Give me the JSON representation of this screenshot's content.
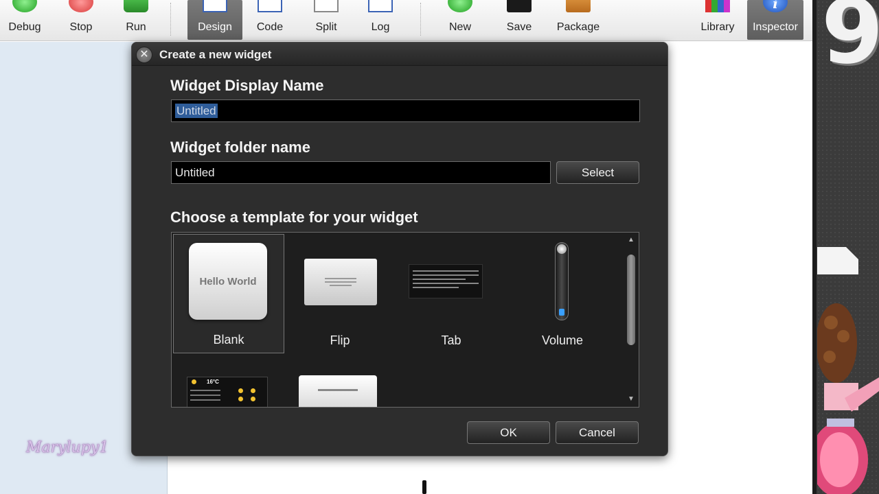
{
  "toolbar": {
    "buttons": [
      {
        "label": "Debug"
      },
      {
        "label": "Stop"
      },
      {
        "label": "Run"
      },
      {
        "label": "Design"
      },
      {
        "label": "Code"
      },
      {
        "label": "Split"
      },
      {
        "label": "Log"
      },
      {
        "label": "New"
      },
      {
        "label": "Save"
      },
      {
        "label": "Package"
      },
      {
        "label": "Library"
      },
      {
        "label": "Inspector"
      }
    ],
    "active": [
      "Design",
      "Inspector"
    ]
  },
  "dialog": {
    "title": "Create a new widget",
    "close_icon": "✕",
    "display_name": {
      "label": "Widget Display Name",
      "value": "Untitled"
    },
    "folder_name": {
      "label": "Widget folder name",
      "value": "Untitled",
      "select_label": "Select"
    },
    "templates": {
      "label": "Choose a template for your widget",
      "items": [
        {
          "name": "Blank",
          "thumb_text": "Hello World"
        },
        {
          "name": "Flip"
        },
        {
          "name": "Tab"
        },
        {
          "name": "Volume"
        }
      ],
      "weather_thumb_temp": "16°C"
    },
    "ok_label": "OK",
    "cancel_label": "Cancel"
  },
  "watermark": "Marylupy1",
  "background_digit": "9"
}
